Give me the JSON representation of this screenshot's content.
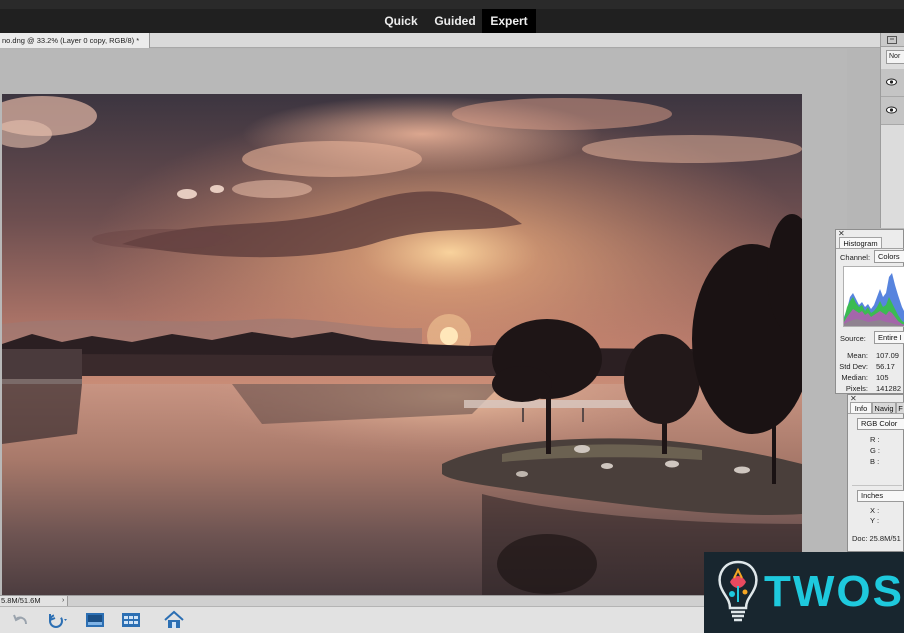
{
  "mode_bar": {
    "tabs": [
      {
        "label": "Quick",
        "active": false
      },
      {
        "label": "Guided",
        "active": false
      },
      {
        "label": "Expert",
        "active": true
      }
    ]
  },
  "document": {
    "tab_title": "no.dng @ 33.2% (Layer 0 copy, RGB/8) *"
  },
  "layers_panel": {
    "blend_mode": "Nor"
  },
  "histogram": {
    "tab_label": "Histogram",
    "channel_label": "Channel:",
    "channel_value": "Colors",
    "source_label": "Source:",
    "source_value": "Entire I",
    "stats": [
      {
        "label": "Mean:",
        "value": "107.09"
      },
      {
        "label": "Std Dev:",
        "value": "56.17"
      },
      {
        "label": "Median:",
        "value": "105"
      },
      {
        "label": "Pixels:",
        "value": "141282"
      }
    ]
  },
  "info_panel": {
    "tabs": [
      "Info",
      "Navig",
      "F"
    ],
    "color_mode": "RGB Color",
    "channels": [
      "R :",
      "G :",
      "B :"
    ],
    "units": "Inches",
    "coords": [
      "X :",
      "Y :"
    ],
    "doc_size": "Doc: 25.8M/51"
  },
  "status_bar": {
    "size": "5.8M/51.6M"
  },
  "taskbar": {
    "icons": [
      "undo-icon",
      "rotate-icon",
      "layout-icon",
      "organizer-icon",
      "home-icon"
    ]
  },
  "watermark": {
    "text": "TWOS"
  },
  "colors": {
    "mode_bar_bg": "#202020",
    "active_tab_bg": "#000000",
    "panel_bg": "#ececec",
    "watermark_bg": "#18262f",
    "watermark_text": "#1ec9dd"
  }
}
